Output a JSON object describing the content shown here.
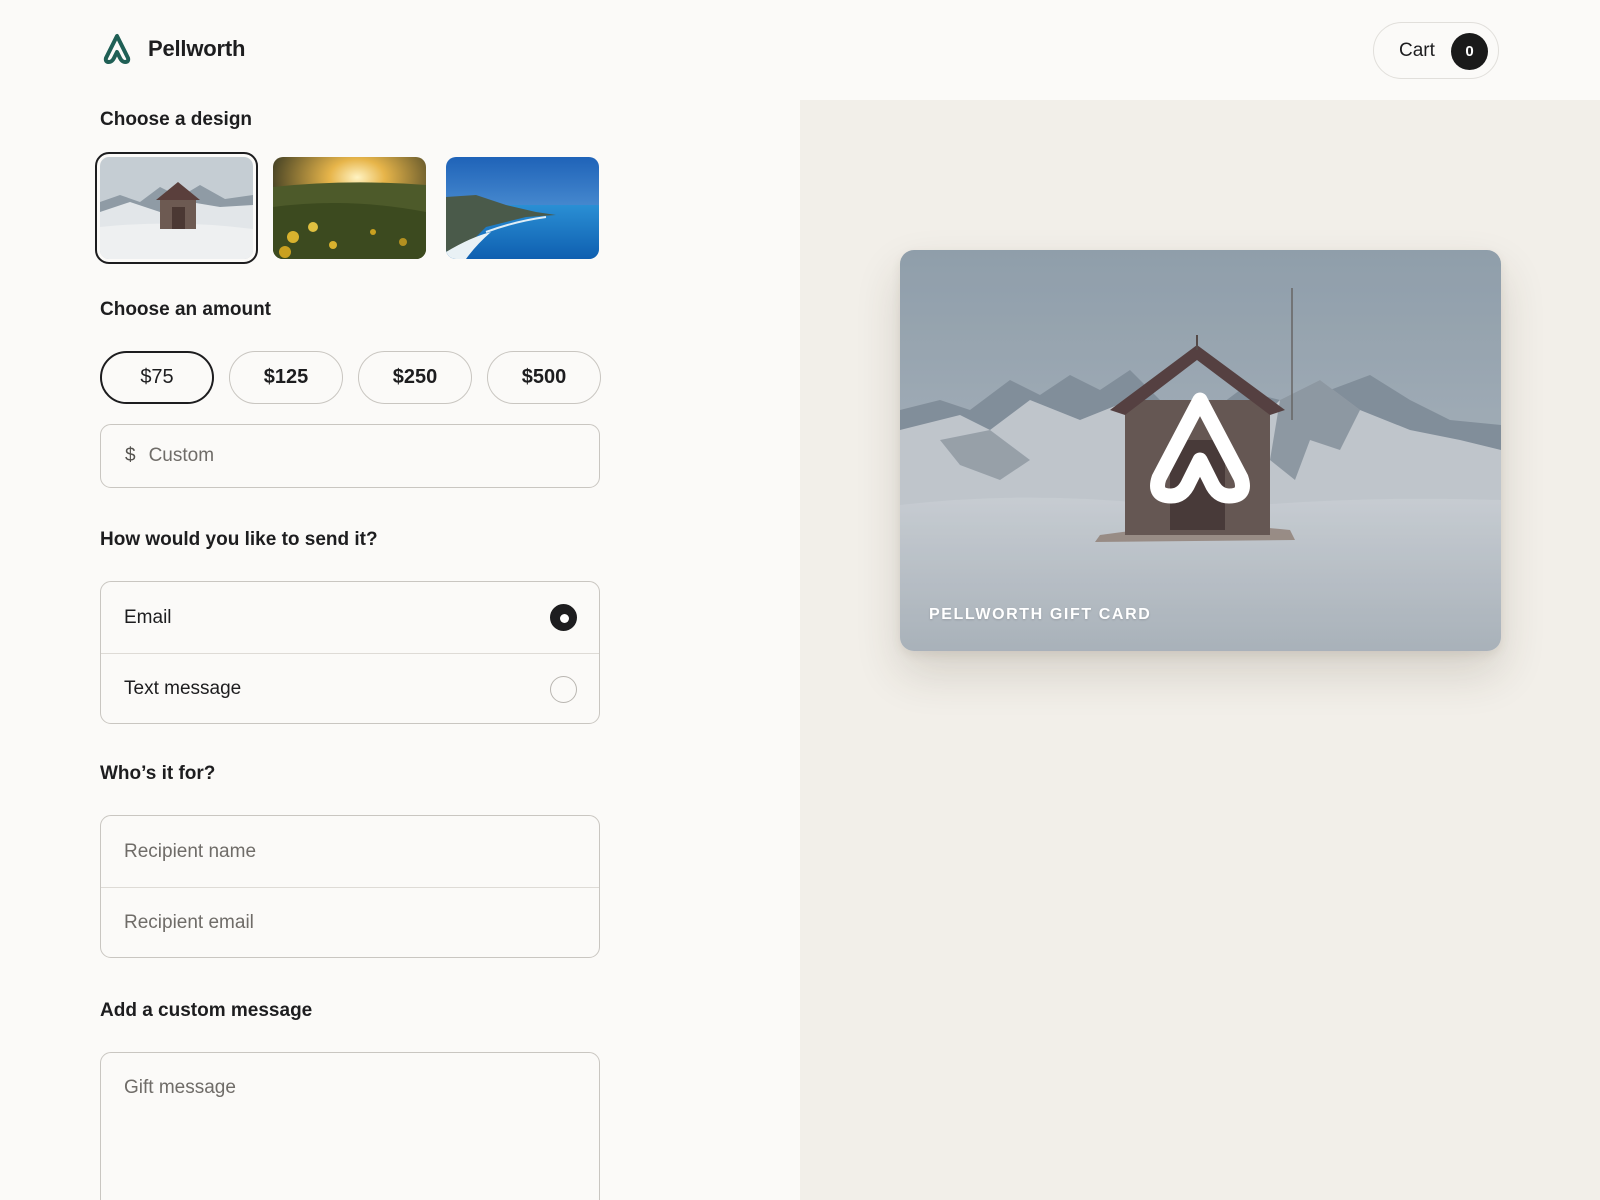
{
  "header": {
    "brand_name": "Pellworth",
    "cart_label": "Cart",
    "cart_count": "0"
  },
  "design": {
    "title": "Choose a design",
    "options": [
      {
        "name": "mountain-cabin",
        "selected": true
      },
      {
        "name": "meadow-sunset",
        "selected": false
      },
      {
        "name": "ocean-coast",
        "selected": false
      }
    ]
  },
  "amount": {
    "title": "Choose an amount",
    "options": [
      "$75",
      "$125",
      "$250",
      "$500"
    ],
    "selected": "$75",
    "custom_prefix": "$",
    "custom_placeholder": "Custom",
    "custom_value": ""
  },
  "delivery": {
    "title": "How would you like to send it?",
    "options": [
      {
        "label": "Email",
        "checked": true
      },
      {
        "label": "Text message",
        "checked": false
      }
    ]
  },
  "recipient": {
    "title": "Who’s it for?",
    "name_placeholder": "Recipient name",
    "email_placeholder": "Recipient email"
  },
  "message": {
    "title": "Add a custom message",
    "placeholder": "Gift message"
  },
  "preview": {
    "caption": "PELLWORTH GIFT CARD"
  },
  "colors": {
    "brand_logo": "#1f5f55",
    "text": "#1d1d1f",
    "page_background": "#fbfaf8",
    "preview_background": "#f2efe9",
    "border": "#c9c6c1"
  },
  "icons": {
    "brand": "pellworth-logo-icon",
    "radio_checked": "radio-checked-icon",
    "radio_unchecked": "radio-unchecked-icon"
  }
}
